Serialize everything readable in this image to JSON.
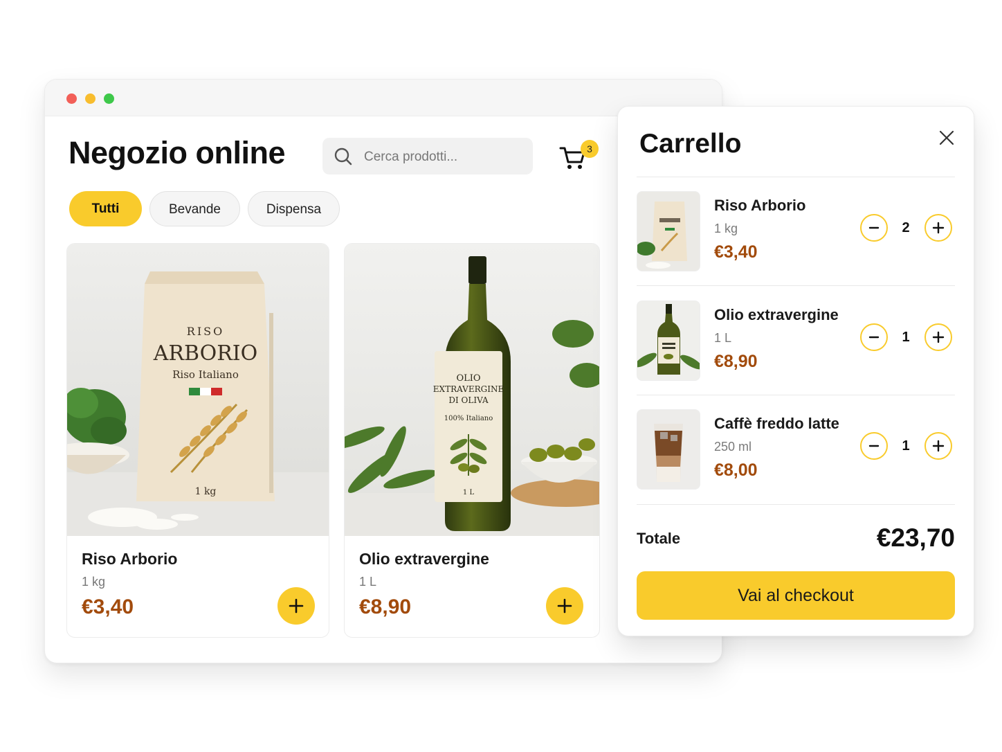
{
  "store": {
    "title": "Negozio online",
    "search_placeholder": "Cerca prodotti...",
    "cart_count": "3",
    "filters": [
      "Tutti",
      "Bevande",
      "Dispensa"
    ],
    "products": [
      {
        "name": "Riso Arborio",
        "size": "1 kg",
        "price": "€3,40",
        "package_text": {
          "line1": "RISO",
          "line2": "ARBORIO",
          "line3": "Riso Italiano",
          "weight": "1 kg"
        }
      },
      {
        "name": "Olio extravergine",
        "size": "1 L",
        "price": "€8,90",
        "label_text": {
          "line1": "OLIO",
          "line2": "EXTRAVERGINE",
          "line3": "DI OLIVA",
          "line4": "100% Italiano",
          "volume": "1 L"
        }
      }
    ]
  },
  "cart": {
    "title": "Carrello",
    "items": [
      {
        "name": "Riso Arborio",
        "size": "1 kg",
        "price": "€3,40",
        "qty": "2"
      },
      {
        "name": "Olio extravergine",
        "size": "1 L",
        "price": "€8,90",
        "qty": "1"
      },
      {
        "name": "Caffè freddo latte",
        "size": "250 ml",
        "price": "€8,00",
        "qty": "1"
      }
    ],
    "total_label": "Totale",
    "total_value": "€23,70",
    "checkout_label": "Vai al checkout"
  },
  "colors": {
    "accent": "#f9cb2c",
    "price": "#a24b0c",
    "window_dots": [
      "#f25f58",
      "#f8bd2e",
      "#3ec84a"
    ]
  },
  "icons": [
    "search-icon",
    "cart-icon",
    "plus-icon",
    "minus-icon",
    "close-icon"
  ]
}
